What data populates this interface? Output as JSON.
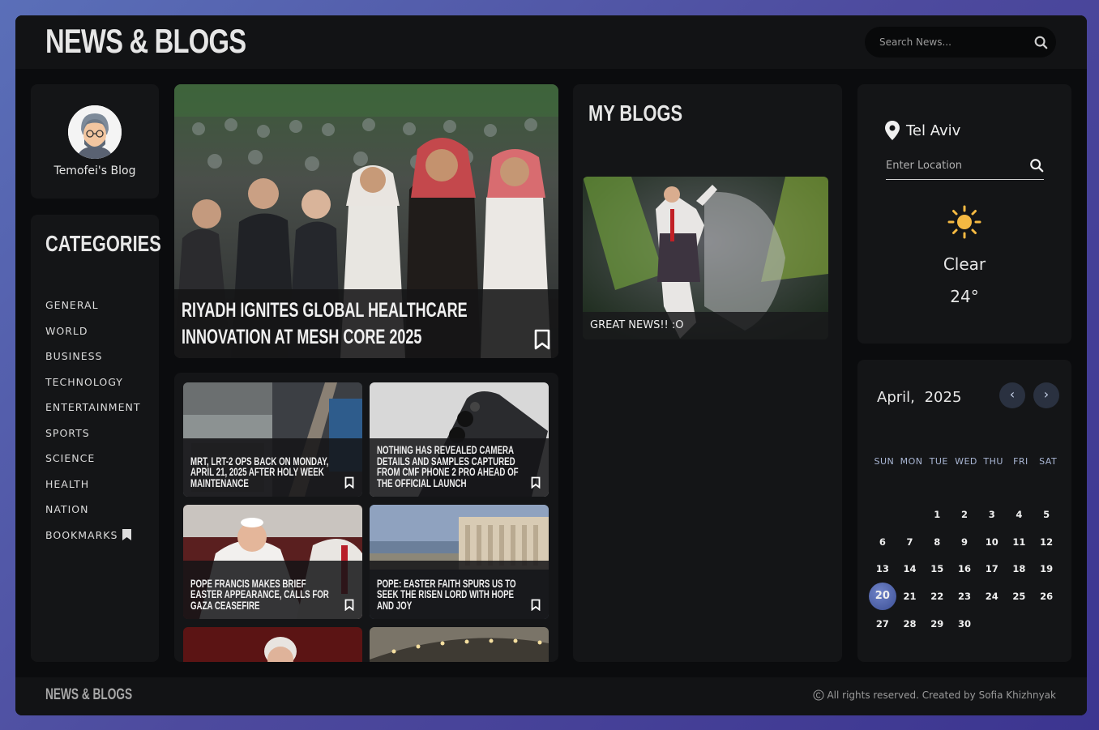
{
  "header": {
    "logo": "NEWS & BLOGS",
    "search_placeholder": "Search News..."
  },
  "profile": {
    "name": "Temofei's Blog"
  },
  "categories": {
    "title": "CATEGORIES",
    "items": [
      "GENERAL",
      "WORLD",
      "BUSINESS",
      "TECHNOLOGY",
      "ENTERTAINMENT",
      "SPORTS",
      "SCIENCE",
      "HEALTH",
      "NATION",
      "BOOKMARKS"
    ]
  },
  "featured": {
    "title": "RIYADH IGNITES GLOBAL HEALTHCARE INNOVATION AT MESH CORE 2025"
  },
  "news": [
    {
      "title": "MRT, LRT-2 OPS BACK ON MONDAY, APRIL 21, 2025 AFTER HOLY WEEK MAINTENANCE"
    },
    {
      "title": "NOTHING HAS REVEALED CAMERA DETAILS AND SAMPLES CAPTURED FROM CMF PHONE 2 PRO AHEAD OF THE OFFICIAL LAUNCH"
    },
    {
      "title": "POPE FRANCIS MAKES BRIEF EASTER APPEARANCE, CALLS FOR GAZA CEASEFIRE"
    },
    {
      "title": "POPE: EASTER FAITH SPURS US TO SEEK THE RISEN LORD WITH HOPE AND JOY"
    }
  ],
  "my_blogs": {
    "title": "MY BLOGS",
    "posts": [
      {
        "title": "GREAT NEWS!! :O"
      }
    ]
  },
  "weather": {
    "city": "Tel Aviv",
    "location_placeholder": "Enter Location",
    "condition": "Clear",
    "temperature": "24°",
    "icon": "sun-icon"
  },
  "calendar": {
    "month": "April,",
    "year": "2025",
    "weekdays": [
      "SUN",
      "MON",
      "TUE",
      "WED",
      "THU",
      "FRI",
      "SAT"
    ],
    "leading_blanks": 2,
    "days": [
      "1",
      "2",
      "3",
      "4",
      "5",
      "6",
      "7",
      "8",
      "9",
      "10",
      "11",
      "12",
      "13",
      "14",
      "15",
      "16",
      "17",
      "18",
      "19",
      "20",
      "21",
      "22",
      "23",
      "24",
      "25",
      "26",
      "27",
      "28",
      "29",
      "30"
    ],
    "today": "20"
  },
  "footer": {
    "logo": "NEWS & BLOGS",
    "copyright": "All rights reserved. Created by Sofia Khizhnyak"
  },
  "colors": {
    "background": "#0b0c0e",
    "card": "#141517",
    "accent": "#5a6fb8",
    "sun": "#f5b942"
  }
}
